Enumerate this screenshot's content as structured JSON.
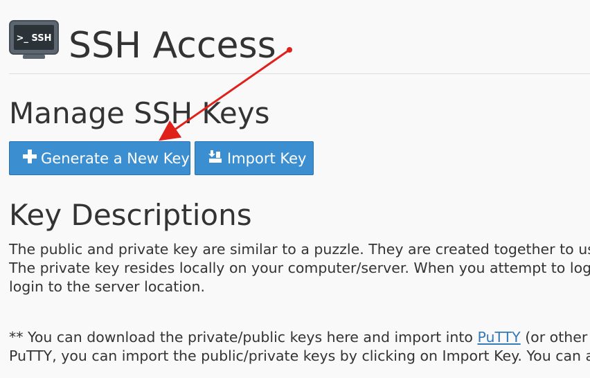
{
  "header": {
    "icon_name": "ssh-terminal-icon",
    "icon_text": ">_ SSH",
    "title": "SSH Access"
  },
  "manage": {
    "title": "Manage SSH Keys",
    "generate_button": {
      "icon": "plus-icon",
      "label": "Generate a New Key"
    },
    "import_button": {
      "icon": "import-icon",
      "label": "Import Key"
    }
  },
  "descriptions": {
    "title": "Key Descriptions",
    "para1_lines": [
      "The public and private key are similar to a puzzle. They are created together to use dur",
      "The private key resides locally on your computer/server. When you attempt to login to",
      "login to the server location."
    ],
    "para2_line1_before": "** You can download the private/public keys here and import into ",
    "para2_link": "PuTTY",
    "para2_line1_after": " (or other SSH",
    "para2_line2": "PuTTY, you can import the public/private keys by clicking on Import Key. You can also c"
  },
  "annotation": {
    "arrow_color": "#e0201b"
  },
  "colors": {
    "button_bg": "#3b8ed0",
    "button_border": "#2672b6",
    "link": "#337ab7",
    "text": "#333333",
    "background": "#f9f9f9"
  }
}
